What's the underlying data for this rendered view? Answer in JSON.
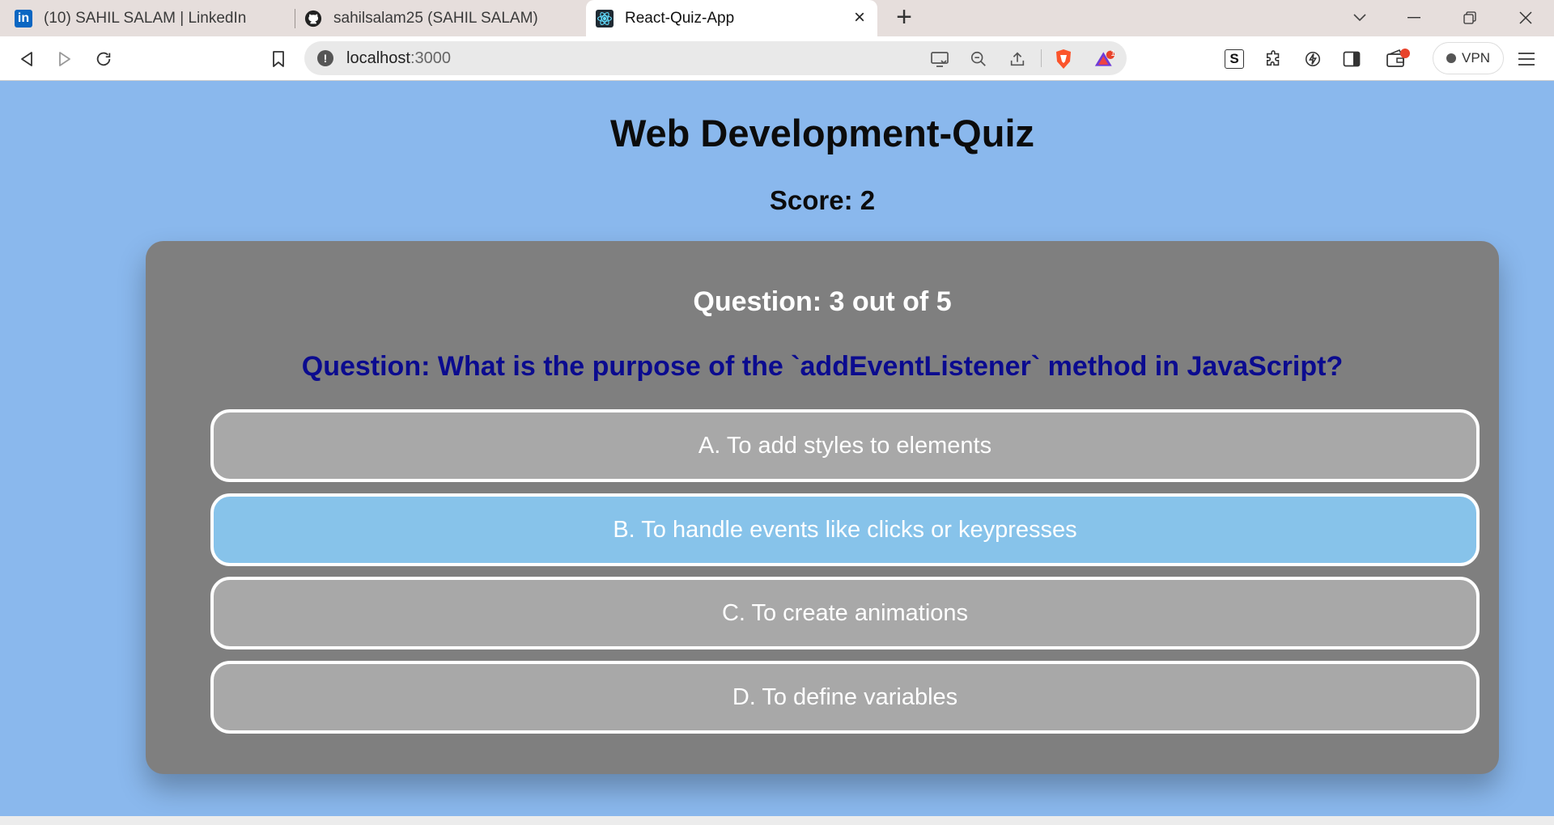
{
  "browser": {
    "tabs": [
      {
        "label": "(10) SAHIL SALAM | LinkedIn",
        "icon": "linkedin-icon"
      },
      {
        "label": "sahilsalam25 (SAHIL SALAM)",
        "icon": "github-icon"
      },
      {
        "label": "React-Quiz-App",
        "icon": "react-icon",
        "active": true
      }
    ],
    "url_host": "localhost",
    "url_port": ":3000",
    "vpn_label": "VPN",
    "notification_badge": "1",
    "accent_brave": "#fb542b",
    "accent_rewards": "#6f3bd8"
  },
  "page": {
    "title": "Web Development-Quiz",
    "score": "Score: 2"
  },
  "quiz": {
    "progress": "Question: 3 out of 5",
    "question": "Question: What is the purpose of the `addEventListener` method in JavaScript?",
    "options": [
      {
        "label": "A. To add styles to elements",
        "selected": false
      },
      {
        "label": "B. To handle events like clicks or keypresses",
        "selected": true
      },
      {
        "label": "C. To create animations",
        "selected": false
      },
      {
        "label": "D. To define variables",
        "selected": false
      }
    ]
  },
  "colors": {
    "page_bg": "#8ab8ed",
    "card_bg": "#7f7f7f",
    "option_bg": "#a8a8a8",
    "option_selected_bg": "#87c3ea",
    "question_text": "#0b0b8f"
  }
}
